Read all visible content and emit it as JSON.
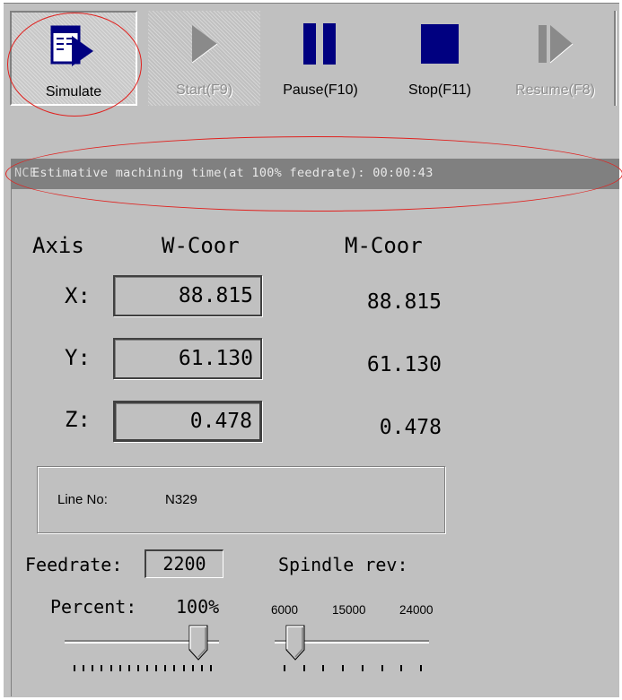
{
  "toolbar": {
    "simulate_label": "Simulate",
    "start_label": "Start(F9)",
    "pause_label": "Pause(F10)",
    "stop_label": "Stop(F11)",
    "resume_label": "Resume(F8)"
  },
  "status": {
    "prefix": "NCE",
    "text": "Estimative machining time(at 100% feedrate): 00:00:43"
  },
  "coords": {
    "axis_header": "Axis",
    "w_header": "W-Coor",
    "m_header": "M-Coor",
    "rows": [
      {
        "axis": "X:",
        "w": "88.815",
        "m": "88.815"
      },
      {
        "axis": "Y:",
        "w": "61.130",
        "m": "61.130"
      },
      {
        "axis": "Z:",
        "w": "0.478",
        "m": "0.478"
      }
    ]
  },
  "line": {
    "label": "Line No:",
    "value": "N329"
  },
  "feed": {
    "label": "Feedrate:",
    "value": "2200"
  },
  "spindle": {
    "label": "Spindle rev:",
    "ticks": [
      "6000",
      "15000",
      "24000"
    ],
    "level": 0
  },
  "percent": {
    "label": "Percent:",
    "value": "100%",
    "level": 1.0
  },
  "colors": {
    "annotation": "#e0221f",
    "icon_blue": "#000080",
    "panel": "#c0c0c0"
  }
}
